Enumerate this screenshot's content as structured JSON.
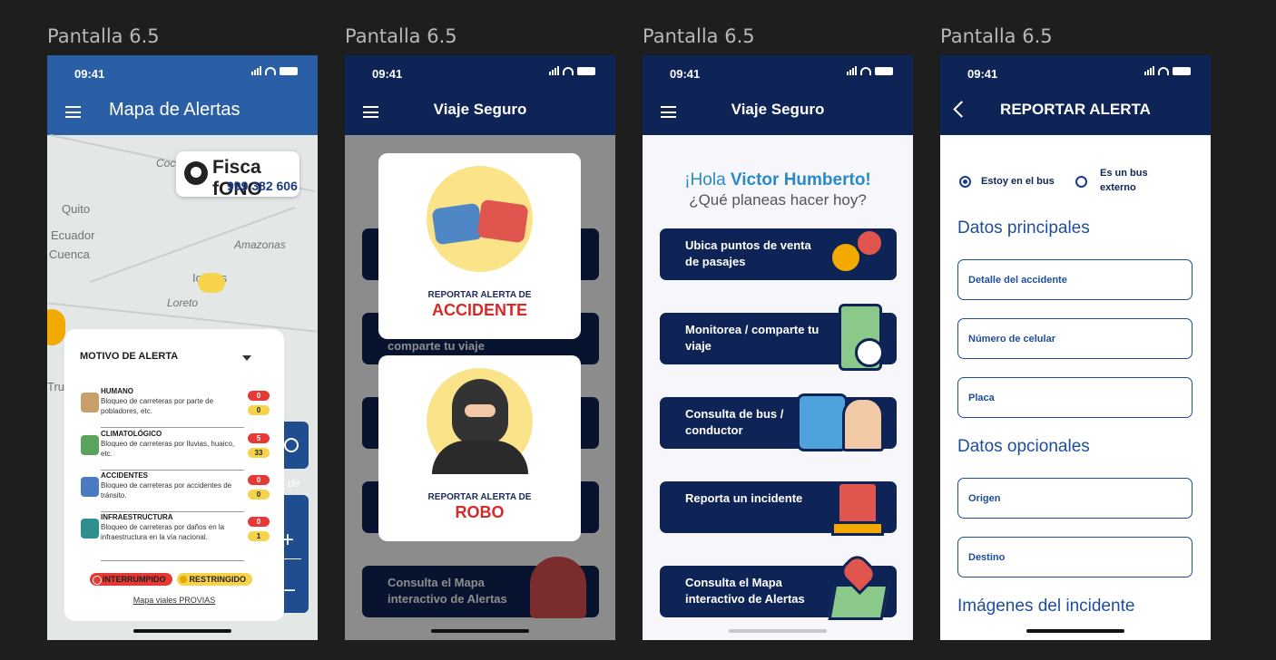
{
  "frames": [
    {
      "label": "Pantalla 6.5"
    },
    {
      "label": "Pantalla 6.5"
    },
    {
      "label": "Pantalla 6.5"
    },
    {
      "label": "Pantalla 6.5"
    }
  ],
  "status": {
    "time": "09:41"
  },
  "colors": {
    "navy": "#0e2456",
    "mapblue": "#2b5fa5",
    "red": "#d42a2a",
    "yellow": "#f7d34b"
  },
  "map_screen": {
    "title": "Mapa de Alertas",
    "map_labels": [
      "Quito",
      "Ecuador",
      "Cuenca",
      "Amazonas",
      "Loreto",
      "Coca",
      "Iquitos",
      "Tru",
      "de"
    ],
    "fisca": {
      "brand": "Fisca fONO",
      "phone": "999 382 606"
    },
    "panel": {
      "title": "MOTIVO DE ALERTA",
      "categories": [
        {
          "name": "HUMANO",
          "desc": "Bloqueo de carreteras por parte de pobladores, etc.",
          "interrumpido": "0",
          "restringido": "0",
          "icon": "person-icon"
        },
        {
          "name": "CLIMATOLÓGICO",
          "desc": "Bloqueo de carreteras por lluvias, huaico, etc.",
          "interrumpido": "5",
          "restringido": "33",
          "icon": "weather-car-icon"
        },
        {
          "name": "ACCIDENTES",
          "desc": "Bloqueo de carreteras por accidentes de tránsito.",
          "interrumpido": "0",
          "restringido": "0",
          "icon": "car-crash-icon"
        },
        {
          "name": "INFRAESTRUCTURA",
          "desc": "Bloqueo de carreteras por daños en la infraestructura en la vía nacional.",
          "interrumpido": "0",
          "restringido": "1",
          "icon": "bridge-icon"
        }
      ],
      "legend": {
        "interrumpido": "INTERRUMPIDO",
        "restringido": "RESTRINGIDO"
      },
      "link": "Mapa viales PROVIAS"
    }
  },
  "menu_modal_screen": {
    "title": "Viaje Seguro",
    "modal_accidente": {
      "line1": "REPORTAR ALERTA DE",
      "line2": "ACCIDENTE",
      "icon": "car-crash-icon"
    },
    "modal_robo": {
      "line1": "REPORTAR ALERTA DE",
      "line2": "ROBO",
      "icon": "thief-icon"
    },
    "visible_cards": [
      "comparte tu viaje",
      "Consulta el Mapa interactivo de Alertas"
    ]
  },
  "home_screen": {
    "title": "Viaje Seguro",
    "greeting_prefix": "¡Hola ",
    "greeting_name": "Victor Humberto!",
    "subtitle": "¿Qué planeas hacer hoy?",
    "cards": [
      {
        "label": "Ubica puntos de venta de pasajes",
        "icon": "location-pins-icon"
      },
      {
        "label": "Monitorea / comparte tu viaje",
        "icon": "phone-map-share-icon"
      },
      {
        "label": "Consulta de bus / conductor",
        "icon": "bus-driver-icon"
      },
      {
        "label": "Reporta un incidente",
        "icon": "alarm-siren-icon"
      },
      {
        "label": "Consulta el Mapa interactivo de Alertas",
        "icon": "map-pin-icon"
      }
    ]
  },
  "report_screen": {
    "title": "REPORTAR ALERTA",
    "radio_in_bus": "Estoy en el bus",
    "radio_external": "Es un bus externo",
    "section_main": "Datos principales",
    "fields_main": [
      "Detalle del accidente",
      "Número de celular",
      "Placa"
    ],
    "section_optional": "Datos opcionales",
    "fields_optional": [
      "Origen",
      "Destino"
    ],
    "section_images": "Imágenes del incidente"
  }
}
